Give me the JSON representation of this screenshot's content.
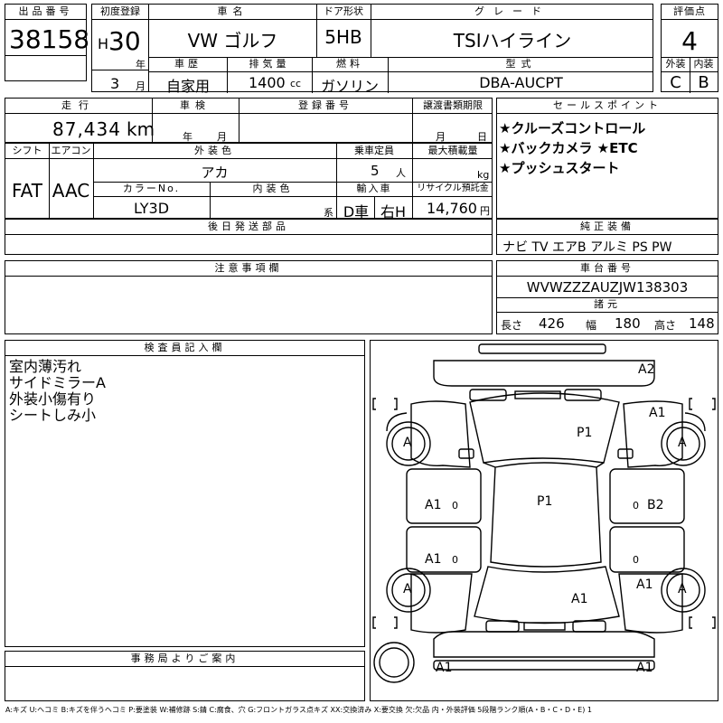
{
  "labels": {
    "lot_no": "出品番号",
    "first_reg": "初度登録",
    "car_name": "車名",
    "door": "ドア形状",
    "grade": "グレード",
    "score": "評価点",
    "history": "車歴",
    "displacement": "排気量",
    "fuel": "燃料",
    "model": "型式",
    "exterior": "外装",
    "interior": "内装",
    "mileage": "走行",
    "inspection": "車検",
    "reg_no": "登録番号",
    "transfer_doc": "譲渡書類期限",
    "sales_points": "セールスポイント",
    "shift": "シフト",
    "aircon": "エアコン",
    "ext_color": "外装色",
    "capacity": "乗車定員",
    "max_load": "最大積載量",
    "color_no": "カラーNo.",
    "int_color": "内装色",
    "import_car": "輸入車",
    "recycle": "リサイクル預託金",
    "later_parts": "後日発送部品",
    "genuine_equip": "純正装備",
    "notes_attn": "注意事項欄",
    "chassis": "車台番号",
    "dims": "諸元",
    "inspector_notes": "検査員記入欄",
    "office_notes": "事務局よりご案内"
  },
  "values": {
    "lot_no": "38158",
    "era": "H",
    "year": "30",
    "year_unit": "年",
    "month": "3",
    "month_unit": "月",
    "car_name": "VW ゴルフ",
    "door": "5HB",
    "grade": "TSIハイライン",
    "score": "4",
    "history": "自家用",
    "displacement": "1400",
    "cc_unit": "cc",
    "fuel": "ガソリン",
    "model": "DBA-AUCPT",
    "ext_grade": "C",
    "int_grade": "B",
    "mileage": "87,434",
    "km": "km",
    "insp_year": "年",
    "insp_month": "月",
    "doc_month": "月",
    "doc_day": "日",
    "shift": "FAT",
    "aircon": "AAC",
    "ext_color": "アカ",
    "capacity": "5",
    "person_unit": "人",
    "kg_unit": "kg",
    "color_no": "LY3D",
    "int_sys": "系",
    "import_d": "D車",
    "import_h": "右H",
    "recycle": "14,760",
    "yen": "円",
    "genuine_equip": "ナビ TV エアB アルミ PS PW",
    "chassis": "WVWZZZAUZJW138303",
    "len_label": "長さ",
    "length": "426",
    "wid_label": "幅",
    "width": "180",
    "hei_label": "高さ",
    "height": "148"
  },
  "sales_points": [
    "★クルーズコントロール",
    "★バックカメラ ★ETC",
    "★プッシュスタート"
  ],
  "inspector_notes": [
    "室内薄汚れ",
    "サイドミラーA",
    "外装小傷有り",
    "シートしみ小"
  ],
  "diagram": {
    "marks": {
      "top_right": "A2",
      "front_right": "A1",
      "hood": "P1",
      "roof": "P1",
      "left_front_door": "A1",
      "left_rear_door": "A1",
      "right_front_door": "B2",
      "right_rear_quarter": "A1",
      "trunk": "A1",
      "rear_left": "A1",
      "rear_right": "A1"
    },
    "tires": [
      "A",
      "A",
      "A",
      "A"
    ],
    "zeros": [
      "0",
      "0",
      "0",
      "0"
    ]
  },
  "legend": "A:キズ U:ヘコミ B:キズを伴うヘコミ P:要塗装 W:補修跡 S:錆 C:腐食、穴 G:フロントガラス点キズ XX:交換済み X:要交換 欠:欠品 内・外装評価 5段階ランク順(A・B・C・D・E) 1"
}
